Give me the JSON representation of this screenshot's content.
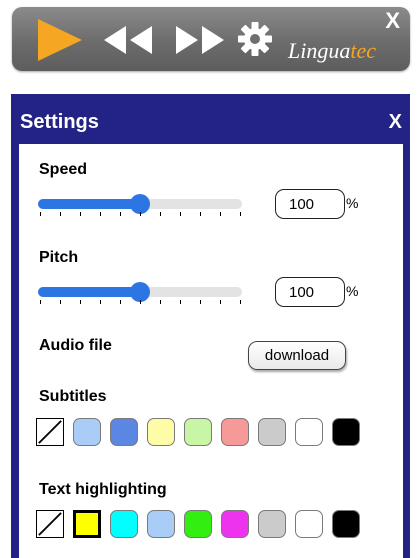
{
  "toolbar": {
    "close_label": "X",
    "brand_part1": "Lingua",
    "brand_part2": "tec",
    "play_icon": "play-icon",
    "rewind_icon": "rewind-icon",
    "forward_icon": "fast-forward-icon",
    "settings_icon": "gear-icon",
    "accent_color": "#f5a623"
  },
  "settings": {
    "title": "Settings",
    "close_label": "X",
    "header_color": "#232386",
    "speed": {
      "label": "Speed",
      "value": "100",
      "unit": "%",
      "slider_fraction": 0.5
    },
    "pitch": {
      "label": "Pitch",
      "value": "100",
      "unit": "%",
      "slider_fraction": 0.5
    },
    "audio": {
      "label": "Audio file",
      "button_label": "download"
    },
    "subtitles": {
      "label": "Subtitles",
      "colors": [
        "none",
        "#a9cdf7",
        "#5b86e1",
        "#fffca8",
        "#c9f5a6",
        "#f59999",
        "#cbcbcb",
        "#ffffff",
        "#000000"
      ],
      "selected_index": 0
    },
    "text_highlighting": {
      "label": "Text highlighting",
      "colors": [
        "none",
        "#ffff00",
        "#00ffff",
        "#a9cdf7",
        "#33ee11",
        "#ee33ee",
        "#cbcbcb",
        "#ffffff",
        "#000000"
      ],
      "selected_index": 1
    }
  }
}
